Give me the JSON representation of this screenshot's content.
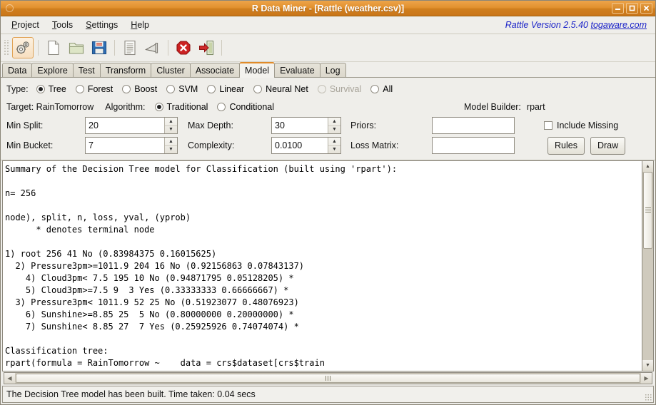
{
  "window": {
    "title": "R Data Miner - [Rattle (weather.csv)]",
    "minimize": "–",
    "maximize": "□",
    "close": "✕"
  },
  "menubar": {
    "items": [
      {
        "label": "Project",
        "accel": "P"
      },
      {
        "label": "Tools",
        "accel": "T"
      },
      {
        "label": "Settings",
        "accel": "S"
      },
      {
        "label": "Help",
        "accel": "H"
      }
    ],
    "brand_version": "Rattle Version 2.5.40",
    "brand_link": "togaware.com"
  },
  "toolbar": {
    "items": [
      {
        "name": "execute-icon",
        "title": "Execute"
      },
      {
        "name": "new-icon",
        "title": "New"
      },
      {
        "name": "open-icon",
        "title": "Open"
      },
      {
        "name": "save-icon",
        "title": "Save"
      },
      {
        "name": "report-icon",
        "title": "Report"
      },
      {
        "name": "export-icon",
        "title": "Export"
      },
      {
        "name": "stop-icon",
        "title": "Stop"
      },
      {
        "name": "quit-icon",
        "title": "Quit"
      }
    ]
  },
  "tabs": [
    {
      "label": "Data",
      "selected": false
    },
    {
      "label": "Explore",
      "selected": false
    },
    {
      "label": "Test",
      "selected": false
    },
    {
      "label": "Transform",
      "selected": false
    },
    {
      "label": "Cluster",
      "selected": false
    },
    {
      "label": "Associate",
      "selected": false
    },
    {
      "label": "Model",
      "selected": true
    },
    {
      "label": "Evaluate",
      "selected": false
    },
    {
      "label": "Log",
      "selected": false
    }
  ],
  "options": {
    "type_label": "Type:",
    "types": [
      {
        "label": "Tree",
        "selected": true,
        "disabled": false
      },
      {
        "label": "Forest",
        "selected": false,
        "disabled": false
      },
      {
        "label": "Boost",
        "selected": false,
        "disabled": false
      },
      {
        "label": "SVM",
        "selected": false,
        "disabled": false
      },
      {
        "label": "Linear",
        "selected": false,
        "disabled": false
      },
      {
        "label": "Neural Net",
        "selected": false,
        "disabled": false
      },
      {
        "label": "Survival",
        "selected": false,
        "disabled": true
      },
      {
        "label": "All",
        "selected": false,
        "disabled": false
      }
    ],
    "target_label": "Target: RainTomorrow",
    "algorithm_label": "Algorithm:",
    "algorithms": [
      {
        "label": "Traditional",
        "selected": true
      },
      {
        "label": "Conditional",
        "selected": false
      }
    ],
    "model_builder_label": "Model Builder:",
    "model_builder_value": "rpart",
    "min_split_label": "Min Split:",
    "min_split_value": "20",
    "max_depth_label": "Max Depth:",
    "max_depth_value": "30",
    "priors_label": "Priors:",
    "priors_value": "",
    "include_missing_label": "Include Missing",
    "include_missing_checked": false,
    "min_bucket_label": "Min Bucket:",
    "min_bucket_value": "7",
    "complexity_label": "Complexity:",
    "complexity_value": "0.0100",
    "loss_matrix_label": "Loss Matrix:",
    "loss_matrix_value": "",
    "rules_button": "Rules",
    "draw_button": "Draw"
  },
  "textview": {
    "content": "Summary of the Decision Tree model for Classification (built using 'rpart'):\n\nn= 256\n\nnode), split, n, loss, yval, (yprob)\n      * denotes terminal node\n\n1) root 256 41 No (0.83984375 0.16015625)\n  2) Pressure3pm>=1011.9 204 16 No (0.92156863 0.07843137)\n    4) Cloud3pm< 7.5 195 10 No (0.94871795 0.05128205) *\n    5) Cloud3pm>=7.5 9  3 Yes (0.33333333 0.66666667) *\n  3) Pressure3pm< 1011.9 52 25 No (0.51923077 0.48076923)\n    6) Sunshine>=8.85 25  5 No (0.80000000 0.20000000) *\n    7) Sunshine< 8.85 27  7 Yes (0.25925926 0.74074074) *\n\nClassification tree:\nrpart(formula = RainTomorrow ~    data = crs$dataset[crs$train"
  },
  "statusbar": {
    "message": "The Decision Tree model has been built. Time taken: 0.04 secs"
  },
  "colors": {
    "titlebar_accent": "#e2912f",
    "tab_selected_accent": "#e08a28",
    "brand_text": "#1a22c8",
    "stop_icon": "#cc2222"
  }
}
